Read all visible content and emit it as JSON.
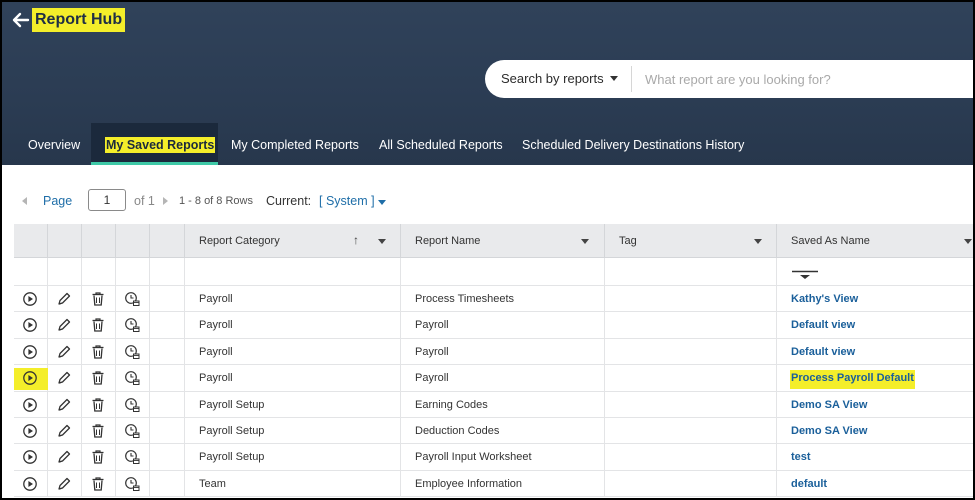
{
  "header": {
    "title": "Report Hub",
    "search": {
      "type_label": "Search by reports",
      "placeholder": "What report are you looking for?"
    },
    "tabs": [
      {
        "label": "Overview",
        "active": false
      },
      {
        "label": "My Saved Reports",
        "active": true
      },
      {
        "label": "My Completed Reports",
        "active": false
      },
      {
        "label": "All Scheduled Reports",
        "active": false
      },
      {
        "label": "Scheduled Delivery Destinations History",
        "active": false
      }
    ]
  },
  "pager": {
    "page_label": "Page",
    "page_value": "1",
    "of_label": "of 1",
    "rows_info": "1 - 8 of 8 Rows",
    "current_label": "Current:",
    "current_value": "[ System ]"
  },
  "grid": {
    "columns": {
      "category": "Report Category",
      "name": "Report Name",
      "tag": "Tag",
      "saved_as": "Saved As Name"
    },
    "rows": [
      {
        "category": "Payroll",
        "name": "Process Timesheets",
        "tag": "",
        "saved_as": "Kathy's View",
        "highlight": false
      },
      {
        "category": "Payroll",
        "name": "Payroll",
        "tag": "",
        "saved_as": "Default view",
        "highlight": false
      },
      {
        "category": "Payroll",
        "name": "Payroll",
        "tag": "",
        "saved_as": "Default view",
        "highlight": false
      },
      {
        "category": "Payroll",
        "name": "Payroll",
        "tag": "",
        "saved_as": "Process Payroll Default",
        "highlight": true
      },
      {
        "category": "Payroll Setup",
        "name": "Earning Codes",
        "tag": "",
        "saved_as": "Demo SA View",
        "highlight": false
      },
      {
        "category": "Payroll Setup",
        "name": "Deduction Codes",
        "tag": "",
        "saved_as": "Demo SA View",
        "highlight": false
      },
      {
        "category": "Payroll Setup",
        "name": "Payroll Input Worksheet",
        "tag": "",
        "saved_as": "test",
        "highlight": false
      },
      {
        "category": "Team",
        "name": "Employee Information",
        "tag": "",
        "saved_as": "default",
        "highlight": false
      }
    ]
  },
  "icons": [
    "back-arrow-icon",
    "run-icon",
    "edit-icon",
    "delete-icon",
    "schedule-icon",
    "filter-icon"
  ],
  "colors": {
    "header_bg": "#2b3c53",
    "highlight": "#f4ee2a",
    "active_tab_underline": "#3ec9a7",
    "link": "#1a5f9a"
  }
}
